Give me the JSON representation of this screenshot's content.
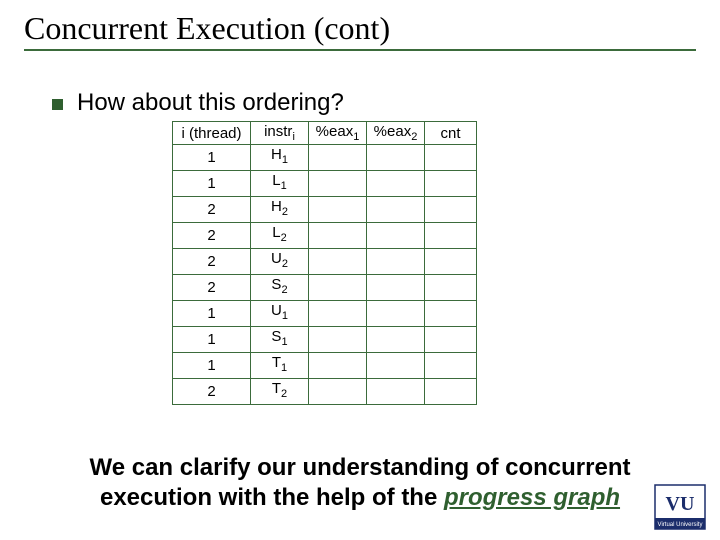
{
  "title": "Concurrent Execution (cont)",
  "bullet": "How about this ordering?",
  "table": {
    "headers": {
      "i": "i (thread)",
      "instr_base": "instr",
      "instr_sub": "i",
      "eax1_base": "%eax",
      "eax1_sub": "1",
      "eax2_base": "%eax",
      "eax2_sub": "2",
      "cnt": "cnt"
    },
    "rows": [
      {
        "i": "1",
        "instr_base": "H",
        "instr_sub": "1",
        "eax1": "",
        "eax2": "",
        "cnt": ""
      },
      {
        "i": "1",
        "instr_base": "L",
        "instr_sub": "1",
        "eax1": "",
        "eax2": "",
        "cnt": ""
      },
      {
        "i": "2",
        "instr_base": "H",
        "instr_sub": "2",
        "eax1": "",
        "eax2": "",
        "cnt": ""
      },
      {
        "i": "2",
        "instr_base": "L",
        "instr_sub": "2",
        "eax1": "",
        "eax2": "",
        "cnt": ""
      },
      {
        "i": "2",
        "instr_base": "U",
        "instr_sub": "2",
        "eax1": "",
        "eax2": "",
        "cnt": ""
      },
      {
        "i": "2",
        "instr_base": "S",
        "instr_sub": "2",
        "eax1": "",
        "eax2": "",
        "cnt": ""
      },
      {
        "i": "1",
        "instr_base": "U",
        "instr_sub": "1",
        "eax1": "",
        "eax2": "",
        "cnt": ""
      },
      {
        "i": "1",
        "instr_base": "S",
        "instr_sub": "1",
        "eax1": "",
        "eax2": "",
        "cnt": ""
      },
      {
        "i": "1",
        "instr_base": "T",
        "instr_sub": "1",
        "eax1": "",
        "eax2": "",
        "cnt": ""
      },
      {
        "i": "2",
        "instr_base": "T",
        "instr_sub": "2",
        "eax1": "",
        "eax2": "",
        "cnt": ""
      }
    ]
  },
  "conclusion_pre": "We can clarify our understanding of concurrent execution with the help of the ",
  "conclusion_em": "progress graph",
  "logo": {
    "top": "VU",
    "bottom": "Virtual University"
  }
}
